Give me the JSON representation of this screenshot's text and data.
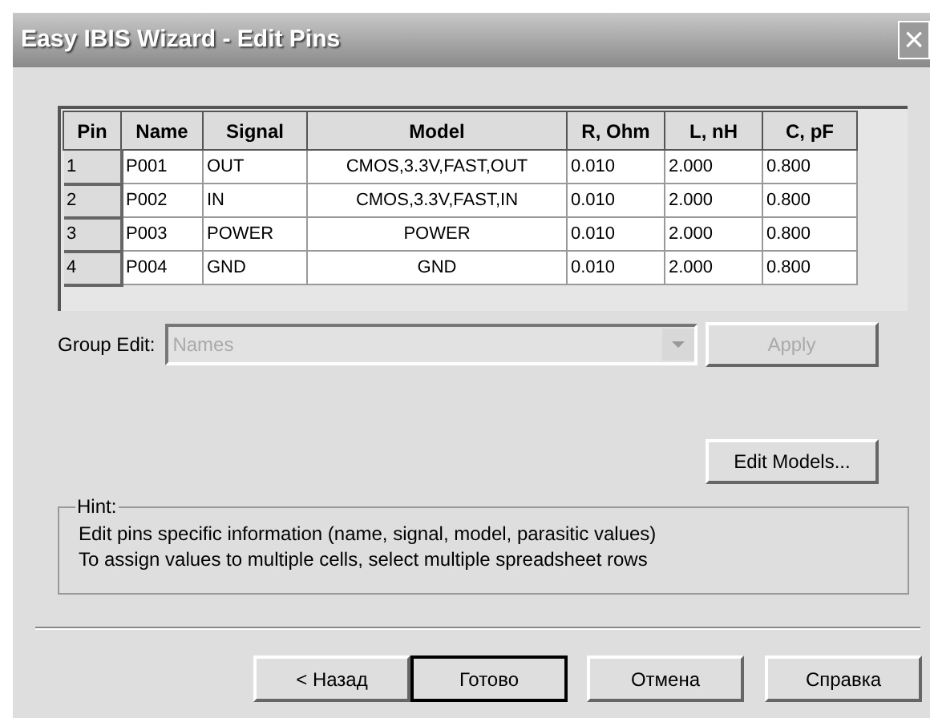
{
  "window": {
    "title": "Easy IBIS Wizard - Edit Pins",
    "close": "×"
  },
  "table": {
    "columns": [
      "Pin",
      "Name",
      "Signal",
      "Model",
      "R, Ohm",
      "L, nH",
      "C, pF"
    ],
    "rows": [
      [
        "1",
        "P001",
        "OUT",
        "CMOS,3.3V,FAST,OUT",
        "0.010",
        "2.000",
        "0.800"
      ],
      [
        "2",
        "P002",
        "IN",
        "CMOS,3.3V,FAST,IN",
        "0.010",
        "2.000",
        "0.800"
      ],
      [
        "3",
        "P003",
        "POWER",
        "POWER",
        "0.010",
        "2.000",
        "0.800"
      ],
      [
        "4",
        "P004",
        "GND",
        "GND",
        "0.010",
        "2.000",
        "0.800"
      ]
    ]
  },
  "group_edit": {
    "label": "Group Edit:",
    "value": "Names",
    "disabled": true,
    "apply": {
      "label": "Apply",
      "disabled": true
    }
  },
  "edit_models": {
    "label": "Edit Models..."
  },
  "hint": {
    "title": "Hint:",
    "lines": [
      "Edit pins specific information (name, signal, model, parasitic values)",
      "To assign values to multiple cells, select multiple spreadsheet rows"
    ]
  },
  "buttons": [
    {
      "label": "< Назад",
      "default": false
    },
    {
      "label": "Готово",
      "default": true
    },
    {
      "label": "Отмена",
      "default": false
    },
    {
      "label": "Справка",
      "default": false
    }
  ]
}
